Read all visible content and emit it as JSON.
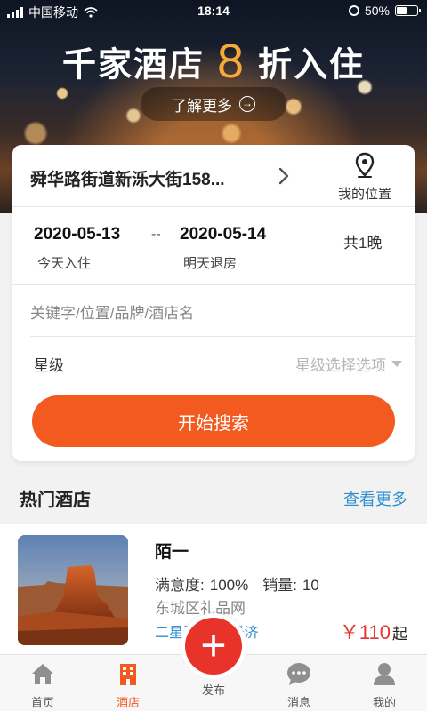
{
  "status": {
    "carrier": "中国移动",
    "time": "18:14",
    "battery": "50%"
  },
  "hero": {
    "title_pre": "千家酒店",
    "title_number": "8",
    "title_post": "折入住",
    "learn_more": "了解更多"
  },
  "search": {
    "location": "舜华路街道新泺大街158...",
    "my_location": "我的位置",
    "checkin_date": "2020-05-13",
    "checkin_label": "今天入住",
    "separator": "--",
    "checkout_date": "2020-05-14",
    "checkout_label": "明天退房",
    "nights": "共1晚",
    "keyword_placeholder": "关键字/位置/品牌/酒店名",
    "keyword_value": "",
    "star_label": "星级",
    "star_select": "星级选择选项",
    "search_button": "开始搜索"
  },
  "hot": {
    "title": "热门酒店",
    "see_more": "查看更多",
    "hotels": [
      {
        "name": "陌一",
        "satisfaction_label": "满意度:",
        "satisfaction": "100%",
        "sales_label": "销量:",
        "sales": "10",
        "address": "东城区礼品网",
        "tag": "二星及以下/经济",
        "price": "￥110",
        "price_suffix": "起"
      }
    ]
  },
  "tabs": [
    {
      "label": "首页",
      "icon": "home-icon"
    },
    {
      "label": "酒店",
      "icon": "hotel-icon",
      "active": true
    },
    {
      "label": "发布",
      "icon": "plus-icon"
    },
    {
      "label": "消息",
      "icon": "message-icon"
    },
    {
      "label": "我的",
      "icon": "user-icon"
    }
  ],
  "colors": {
    "accent": "#f25a1f",
    "link": "#2e8fcf",
    "price": "#e4342a",
    "publish": "#e8332b"
  }
}
